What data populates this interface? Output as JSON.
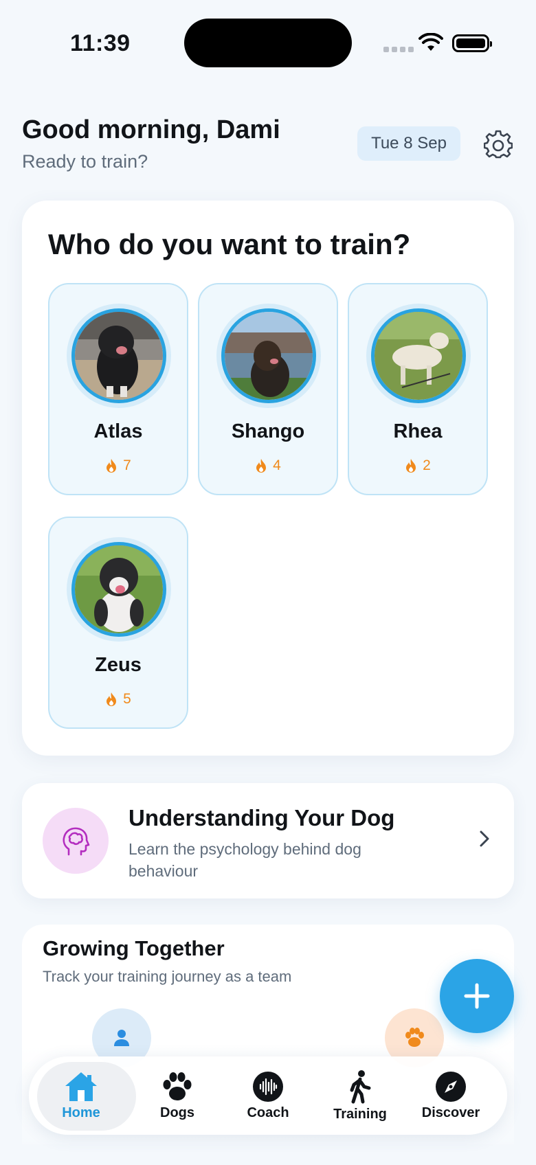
{
  "status_bar": {
    "time": "11:39"
  },
  "header": {
    "greeting": "Good morning, Dami",
    "subtitle": "Ready to train?",
    "date": "Tue 8 Sep"
  },
  "train_card": {
    "title": "Who do you want to train?",
    "dogs": [
      {
        "name": "Atlas",
        "streak": "7"
      },
      {
        "name": "Shango",
        "streak": "4"
      },
      {
        "name": "Rhea",
        "streak": "2"
      },
      {
        "name": "Zeus",
        "streak": "5"
      }
    ]
  },
  "understand_card": {
    "title": "Understanding Your Dog",
    "subtitle": "Learn the psychology behind dog behaviour",
    "icon": "brain-head-icon"
  },
  "growing": {
    "title": "Growing Together",
    "subtitle": "Track your training journey as a team"
  },
  "tabs": [
    {
      "label": "Home",
      "icon": "home-icon",
      "active": true
    },
    {
      "label": "Dogs",
      "icon": "paw-icon",
      "active": false
    },
    {
      "label": "Coach",
      "icon": "voice-wave-icon",
      "active": false
    },
    {
      "label": "Training",
      "icon": "walking-person-icon",
      "active": false
    },
    {
      "label": "Discover",
      "icon": "compass-icon",
      "active": false
    }
  ],
  "colors": {
    "accent": "#2ba4e6",
    "streak": "#f08a1c",
    "background": "#f4f8fc"
  }
}
